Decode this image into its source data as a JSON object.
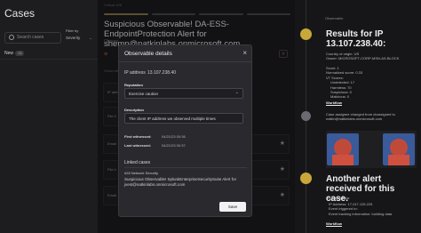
{
  "left": {
    "title": "Cases",
    "search_placeholder": "Search cases",
    "filter_label": "Filter by",
    "filter_value": "Severity",
    "new_label": "New",
    "new_count": "13"
  },
  "middle": {
    "breadcrumb": "Critical  #26",
    "case_title": "Suspicious Observable! DA-ESS-EndpointProtection Alert for shemp@natkinlabs.onmicrosoft.com",
    "subtitle": "Observ",
    "section_label": "Observab",
    "rows": [
      "IP add",
      "File h",
      "Email",
      "File h",
      "Email"
    ]
  },
  "modal": {
    "title": "Observable details",
    "ip_label": "IP address",
    "ip_value": "13.107.238.40",
    "reputation_label": "Reputation",
    "reputation_value": "Exercise caution",
    "description_label": "Description",
    "description_value": "The client IP address we observed multiple times",
    "first_witnessed_label": "First witnessed:",
    "first_witnessed_value": "04/21/23 00:36",
    "last_witnessed_label": "Last witnessed:",
    "last_witnessed_value": "04/21/23 00:37",
    "linked_cases_label": "Linked cases",
    "linked_case_id": "#28  Network Security",
    "linked_case_title": "Suspicious Observable! SplunkEnterpriseSecuritySuite Alert for jvest@natkinlabs.onmicrosoft.com",
    "save_label": "Save"
  },
  "right": {
    "top_meta": "Observable",
    "results_title": "Results for IP 13.107.238.40:",
    "results_lines": [
      "Country of origin: US",
      "Owner: MICROSOFT-CORP-MSN-AS-BLOCK",
      "Score: 1",
      "Normalized score: 0.33",
      "VT Scores:",
      "  Undetected: 17",
      "  Harmless: 70",
      "  Suspicious: 0",
      "  Malicious: 0"
    ],
    "workflow_label": "Workflow",
    "assignee_text": "Case assignee changed from chassigned to natkin@natkinlabs.onmicrosoft.com",
    "another_alert_title": "Another alert received for this case.",
    "important_label": "Important data:",
    "alert_lines": [
      "IP Address: 17.247.125.225",
      "Event triggered to:",
      "Event tracking information: building data"
    ]
  }
}
